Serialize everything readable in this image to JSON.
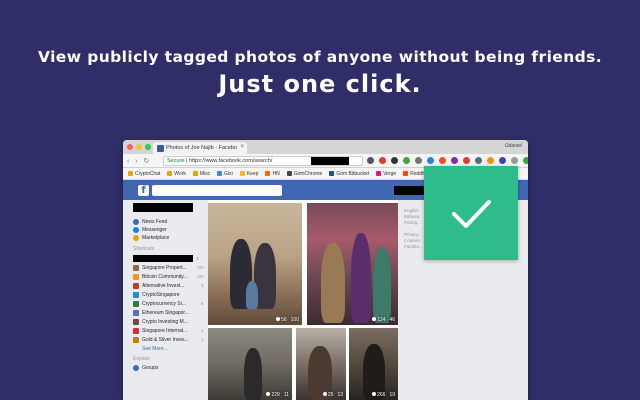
{
  "headline": "View publicly tagged photos of anyone without being friends.",
  "subheadline": "Just one click.",
  "browser": {
    "tab_title": "Photos of Joe Najib - Facebo",
    "tab_close": "×",
    "profile": "Ωdaniel",
    "nav": "‹ › ↻",
    "secure_label": "Secure",
    "url": "https://www.facebook.com/search/",
    "bookmarks": [
      "CryptoChat",
      "Work",
      "Misc",
      "Gixi",
      "Keep",
      "HN",
      "GomChrome",
      "Gom Bitbucket",
      "Verge",
      "Reddit"
    ]
  },
  "sidebar": {
    "items": [
      {
        "label": "News Feed",
        "icon": "news-feed-icon",
        "color": "#4267b2"
      },
      {
        "label": "Messenger",
        "icon": "messenger-icon",
        "color": "#0084ff"
      },
      {
        "label": "Marketplace",
        "icon": "marketplace-icon",
        "color": "#e0a800"
      }
    ],
    "shortcuts_heading": "Shortcuts",
    "shortcut_count_first": "3",
    "shortcuts": [
      {
        "label": "Singapore Propert...",
        "count": "20+"
      },
      {
        "label": "Bitcoin Community...",
        "count": "20+"
      },
      {
        "label": "Alternative Invest...",
        "count": "3"
      },
      {
        "label": "CryptoSingapore",
        "count": ""
      },
      {
        "label": "Cryptocurrency Si...",
        "count": "6"
      },
      {
        "label": "Ethereum Singapor...",
        "count": ""
      },
      {
        "label": "Crypto Investing M...",
        "count": ""
      },
      {
        "label": "Singapore Internat...",
        "count": "1"
      },
      {
        "label": "Gold & Silver Inves...",
        "count": "1"
      }
    ],
    "see_more": "See More...",
    "explore_heading": "Explore",
    "groups_label": "Groups"
  },
  "photos": [
    {
      "likes": "56",
      "comments": "100"
    },
    {
      "likes": "124",
      "comments": "46"
    },
    {
      "likes": "229",
      "comments": "11"
    },
    {
      "likes": "25",
      "comments": "13"
    },
    {
      "likes": "266",
      "comments": "19"
    }
  ],
  "right_column": {
    "lines": [
      "English",
      "Bahasa",
      "Portug...",
      "",
      "Privacy",
      "Cookies",
      "Facebo..."
    ]
  },
  "colors": {
    "background": "#302e68",
    "facebook_blue": "#4267b2",
    "checkmark_bg": "#2ebc8b"
  },
  "icons": {
    "checkmark": "check-icon"
  }
}
